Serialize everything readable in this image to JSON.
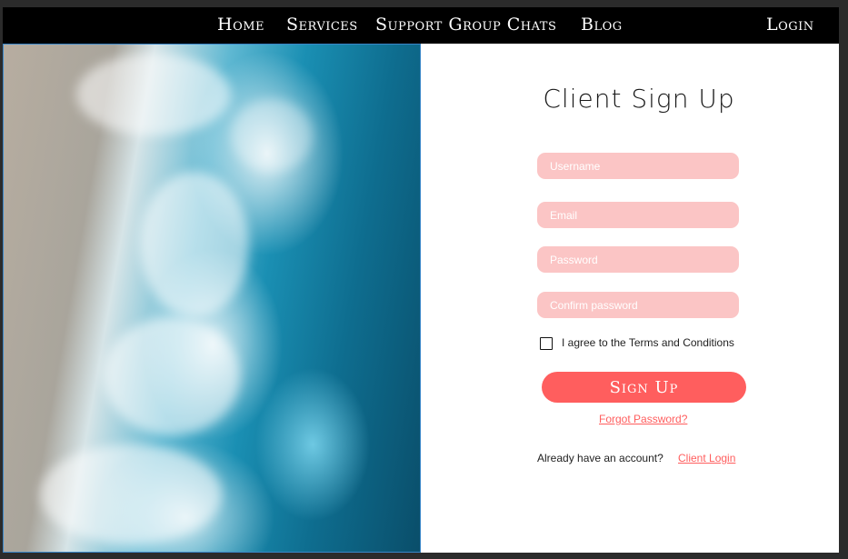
{
  "nav": {
    "items": [
      {
        "label": "Home"
      },
      {
        "label": "Services"
      },
      {
        "label": "Support Group Chats"
      },
      {
        "label": "Blog"
      }
    ],
    "login_label": "Login"
  },
  "hero": {
    "image": "ocean-waves-on-beach-aerial"
  },
  "form": {
    "title": "Client Sign Up",
    "username_placeholder": "Username",
    "email_placeholder": "Email",
    "password_placeholder": "Password",
    "confirm_placeholder": "Confirm password",
    "terms_label": "I agree to the Terms and Conditions",
    "terms_checked": false,
    "signup_label": "Sign Up",
    "forgot_label": "Forgot Password?",
    "already_text": "Already have an account?",
    "client_login_label": "Client Login"
  },
  "colors": {
    "navbar": "#000000",
    "field_bg": "#fbc5c5",
    "accent": "#ff5e5e"
  }
}
